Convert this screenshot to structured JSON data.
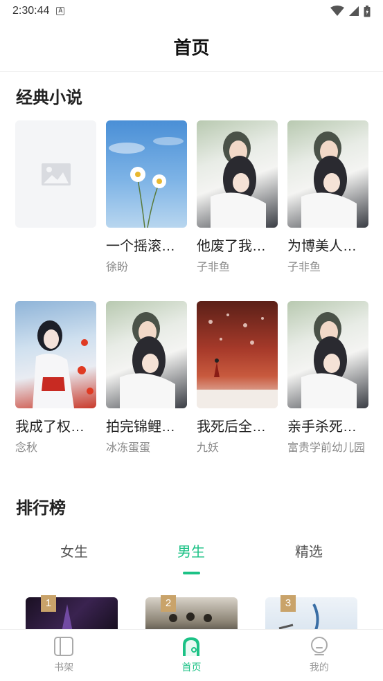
{
  "status_bar": {
    "time": "2:30:44",
    "notification_icon": "A"
  },
  "header": {
    "title": "首页"
  },
  "classic": {
    "title": "经典小说",
    "books": [
      {
        "title": "",
        "author": "",
        "cover": "placeholder"
      },
      {
        "title": "一个摇滚…",
        "author": "徐盼",
        "cover": "sky-flowers"
      },
      {
        "title": "他废了我…",
        "author": "子非鱼",
        "cover": "couple"
      },
      {
        "title": "为博美人…",
        "author": "子非鱼",
        "cover": "couple"
      },
      {
        "title": "我成了权…",
        "author": "念秋",
        "cover": "girl-water"
      },
      {
        "title": "拍完锦鲤…",
        "author": "冰冻蛋蛋",
        "cover": "couple"
      },
      {
        "title": "我死后全…",
        "author": "九妖",
        "cover": "red-wall"
      },
      {
        "title": "亲手杀死…",
        "author": "富贵学前幼儿园",
        "cover": "couple"
      }
    ]
  },
  "ranking": {
    "title": "排行榜",
    "tabs": [
      "女生",
      "男生",
      "精选"
    ],
    "active_tab": "男生",
    "items": [
      "1",
      "2",
      "3"
    ]
  },
  "bottom_nav": {
    "items": [
      {
        "label": "书架",
        "icon": "bookshelf-icon"
      },
      {
        "label": "首页",
        "icon": "home-icon"
      },
      {
        "label": "我的",
        "icon": "profile-icon"
      }
    ],
    "active": "首页"
  },
  "colors": {
    "accent": "#1cc286",
    "rank_badge": "#c9a36a"
  }
}
